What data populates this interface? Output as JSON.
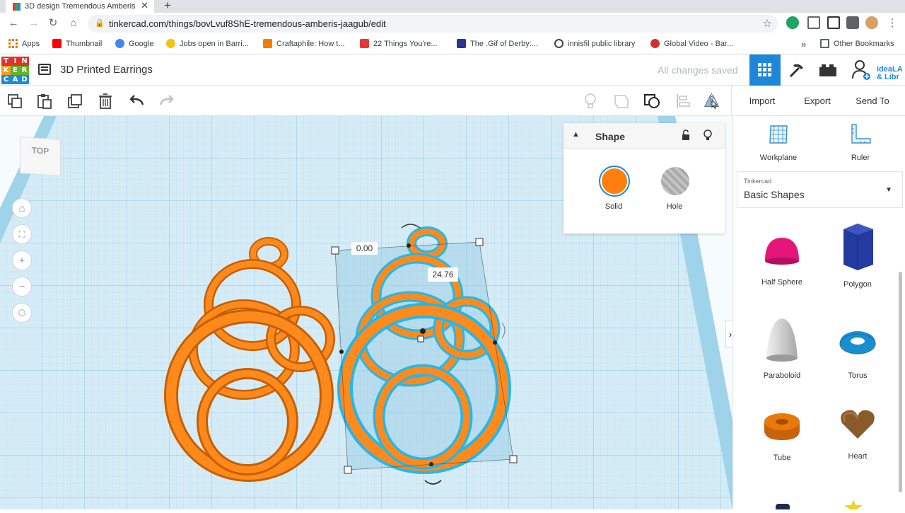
{
  "browser": {
    "tab_title": "3D design Tremendous Amberis",
    "url": "tinkercad.com/things/bovLvuf8ShE-tremendous-amberis-jaagub/edit",
    "bookmarks": [
      {
        "label": "Apps",
        "color": "#e8710a"
      },
      {
        "label": "Thumbnail",
        "color": "#ff0000"
      },
      {
        "label": "Google",
        "color": "#4285f4"
      },
      {
        "label": "Jobs open in Barri...",
        "color": "#f4c20d"
      },
      {
        "label": "Craftaphile: How t...",
        "color": "#f57c00"
      },
      {
        "label": "22 Things You're...",
        "color": "#e53935"
      },
      {
        "label": "The .Gif of Derby:...",
        "color": "#283593"
      },
      {
        "label": "innisfil public library",
        "color": "#444444"
      },
      {
        "label": "Global Video - Bar...",
        "color": "#d32f2f"
      }
    ],
    "more": "»",
    "other_bookmarks": "Other Bookmarks"
  },
  "app": {
    "logo_letters": [
      "T",
      "I",
      "N",
      "K",
      "E",
      "R",
      "C",
      "A",
      "D"
    ],
    "design_title": "3D Printed Earrings",
    "save_status": "All changes saved",
    "user_tag": "ideaLA & Libr"
  },
  "toolbar": {
    "import_label": "Import",
    "export_label": "Export",
    "sendto_label": "Send To"
  },
  "viewport": {
    "viewcube_label": "TOP",
    "dim_width": "0.00",
    "dim_height": "24.76"
  },
  "inspector": {
    "title": "Shape",
    "solid_label": "Solid",
    "hole_label": "Hole",
    "solid_color": "#ff7f0e",
    "hole_color": "#bcbcbc"
  },
  "panel": {
    "workplane_label": "Workplane",
    "ruler_label": "Ruler",
    "library_small": "Tinkercad",
    "library_name": "Basic Shapes",
    "shapes": [
      {
        "label": "Half Sphere",
        "color": "#e5157a"
      },
      {
        "label": "Polygon",
        "color": "#233a9e"
      },
      {
        "label": "Paraboloid",
        "color": "#cfcfcf"
      },
      {
        "label": "Torus",
        "color": "#1a8fcf"
      },
      {
        "label": "Tube",
        "color": "#e8790a"
      },
      {
        "label": "Heart",
        "color": "#8a5a2b"
      }
    ]
  }
}
